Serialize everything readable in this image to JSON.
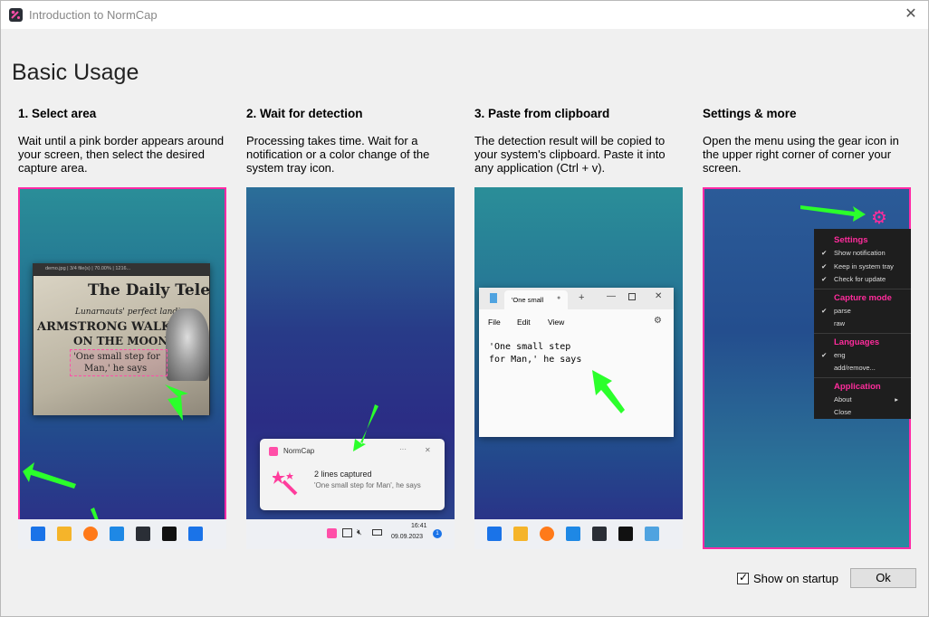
{
  "window": {
    "title": "Introduction to NormCap",
    "close_glyph": "✕"
  },
  "heading": "Basic Usage",
  "steps": [
    {
      "title": "1. Select area",
      "text": "Wait until a pink border appears around your screen, then select the desired capture area."
    },
    {
      "title": "2. Wait for detection",
      "text": "Processing takes time. Wait for a notification or a color change of the system tray icon."
    },
    {
      "title": "3. Paste from clipboard",
      "text": "The detection result will be copied to your system's clipboard. Paste it into any application (Ctrl + v)."
    },
    {
      "title": "Settings & more",
      "text": "Open the menu using the gear icon in the upper right corner of corner your screen."
    }
  ],
  "panel1": {
    "viewer_title": "demo.jpg | 3/4 file(s) | 70.00% | 1216...",
    "newspaper_masthead": "The Daily Teleg",
    "newspaper_subhead": "Lunarnauts' perfect landing",
    "newspaper_headline_1": "ARMSTRONG WALKS",
    "newspaper_headline_2": "ON THE MOON",
    "quote_line_1": "'One small step for",
    "quote_line_2": "Man,' he says"
  },
  "panel2": {
    "notif_app": "NormCap",
    "notif_dots": "···",
    "notif_close": "✕",
    "notif_title": "2 lines captured",
    "notif_body": "'One small step for Man', he says",
    "clock_time": "16:41",
    "clock_date": "09.09.2023",
    "badge": "1"
  },
  "panel3": {
    "tab_label": "'One small",
    "menu_file": "File",
    "menu_edit": "Edit",
    "menu_view": "View",
    "text_line_1": "'One small step",
    "text_line_2": "for Man,' he says"
  },
  "panel4": {
    "sections": [
      {
        "title": "Settings",
        "items": [
          {
            "label": "Show notification",
            "checked": true
          },
          {
            "label": "Keep in system tray",
            "checked": true
          },
          {
            "label": "Check for update",
            "checked": true
          }
        ]
      },
      {
        "title": "Capture mode",
        "items": [
          {
            "label": "parse",
            "checked": true
          },
          {
            "label": "raw",
            "checked": false
          }
        ]
      },
      {
        "title": "Languages",
        "items": [
          {
            "label": "eng",
            "checked": true
          },
          {
            "label": "add/remove...",
            "checked": false
          }
        ]
      },
      {
        "title": "Application",
        "items": [
          {
            "label": "About",
            "checked": false,
            "submenu": true
          },
          {
            "label": "Close",
            "checked": false
          }
        ]
      }
    ]
  },
  "footer": {
    "show_on_startup_label": "Show on startup",
    "show_on_startup_checked": true,
    "ok_label": "Ok"
  },
  "colors": {
    "accent_pink": "#ff2aa6",
    "arrow_green": "#2bff2b"
  }
}
